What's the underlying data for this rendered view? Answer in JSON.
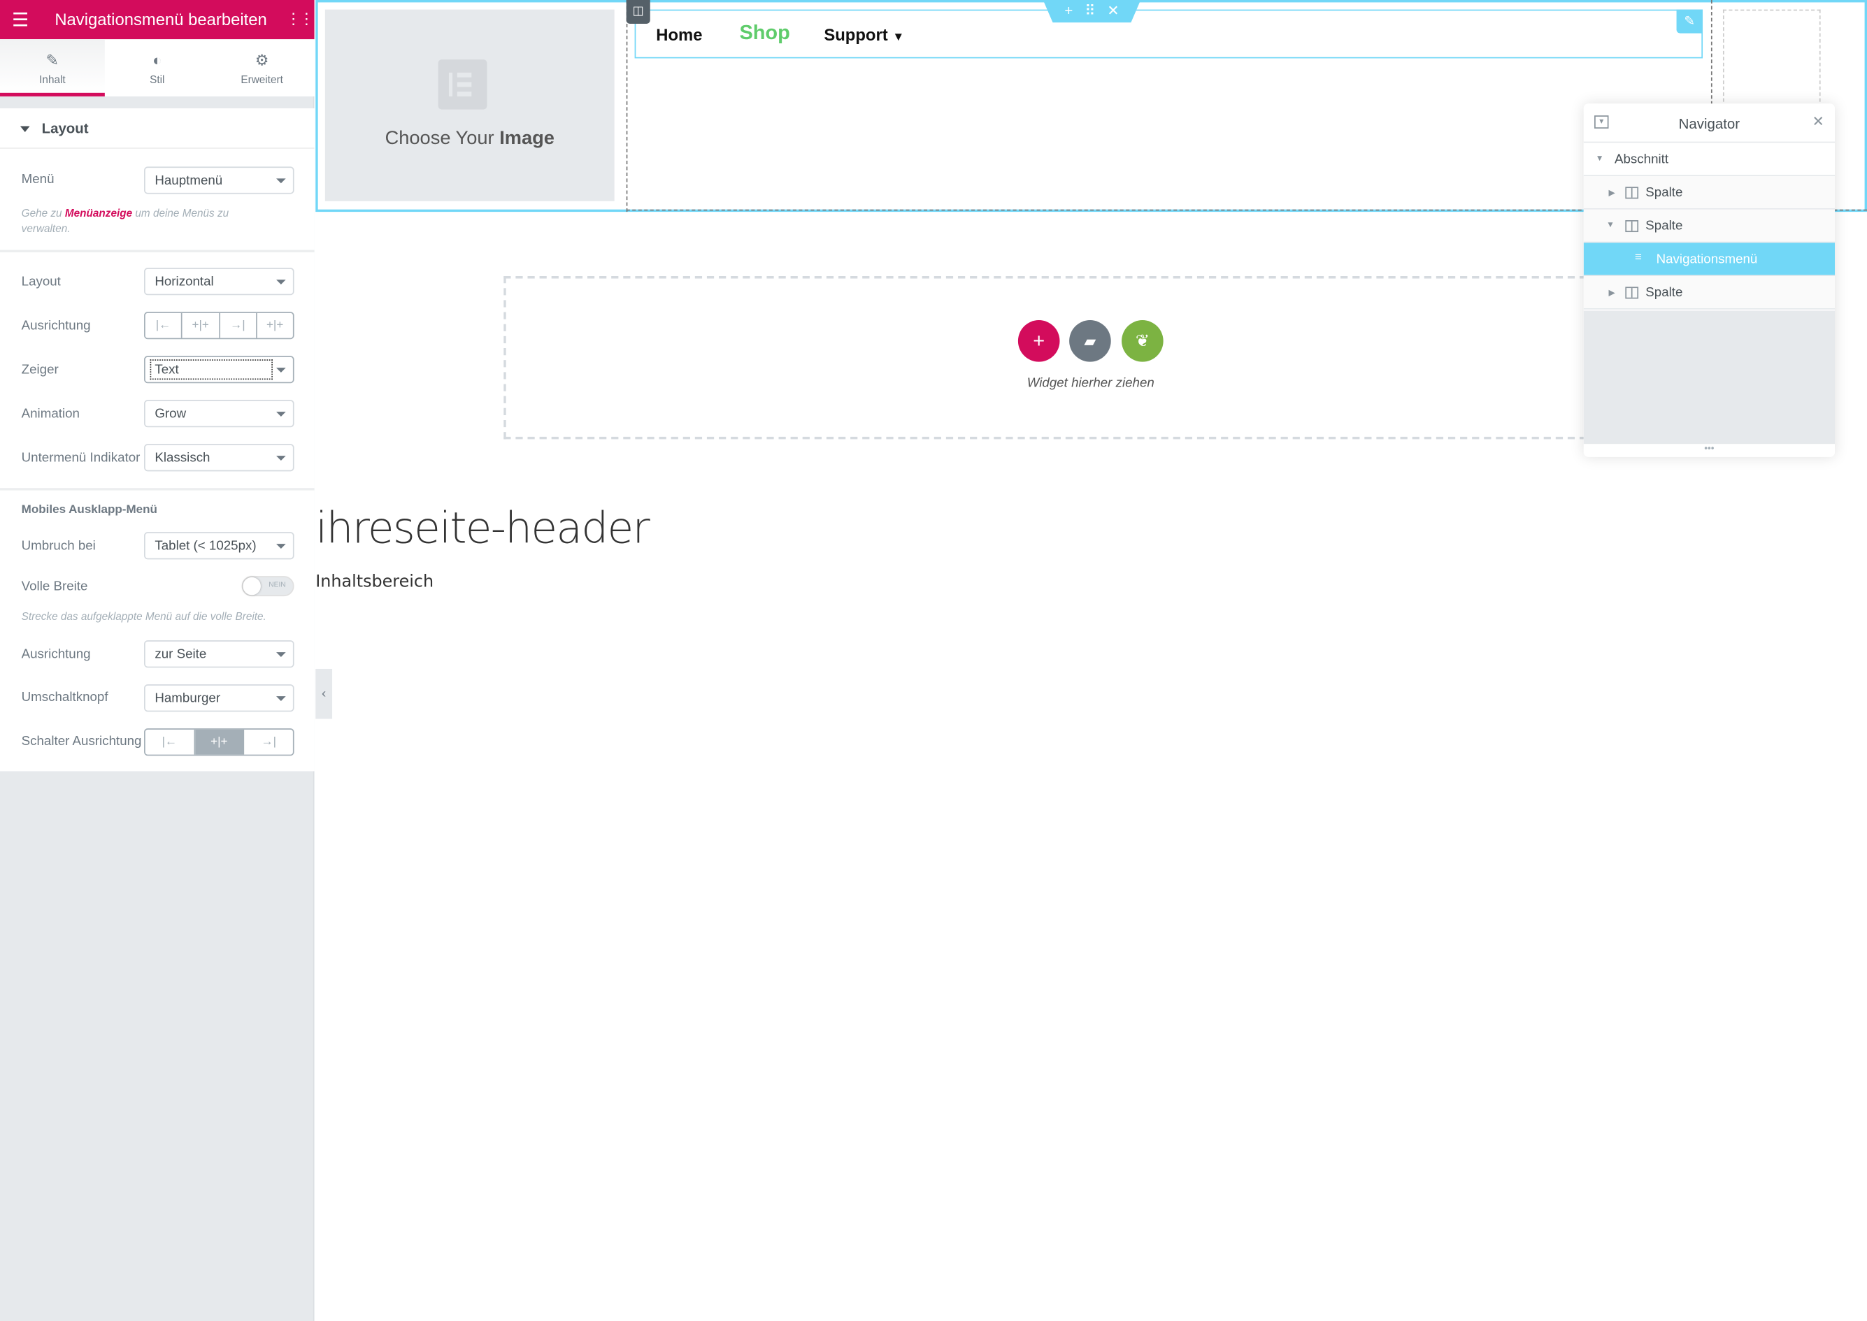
{
  "sidebar": {
    "title": "Navigationsmenü bearbeiten",
    "accent": "#d30c5c",
    "tabs": [
      {
        "label": "Inhalt",
        "icon": "pencil-icon",
        "active": true
      },
      {
        "label": "Stil",
        "icon": "half-circle-icon",
        "active": false
      },
      {
        "label": "Erweitert",
        "icon": "gear-icon",
        "active": false
      }
    ],
    "layout_section": {
      "title": "Layout",
      "menu_label": "Menü",
      "menu_value": "Hauptmenü",
      "hint_prefix": "Gehe zu",
      "hint_link": "Menüanzeige",
      "hint_suffix": "um deine Menüs zu verwalten.",
      "layout_label": "Layout",
      "layout_value": "Horizontal",
      "align_label": "Ausrichtung",
      "pointer_label": "Zeiger",
      "pointer_value": "Text",
      "animation_label": "Animation",
      "animation_value": "Grow",
      "submenu_label": "Untermenü Indikator",
      "submenu_value": "Klassisch"
    },
    "mobile_section": {
      "title": "Mobiles Ausklapp-Menü",
      "breakpoint_label": "Umbruch bei",
      "breakpoint_value": "Tablet (< 1025px)",
      "fullwidth_label": "Volle Breite",
      "fullwidth_toggle": "NEIN",
      "fullwidth_hint": "Strecke das aufgeklappte Menü auf die volle Breite.",
      "align_label": "Ausrichtung",
      "align_value": "zur Seite",
      "toggle_label": "Umschaltknopf",
      "toggle_value": "Hamburger",
      "toggle_align_label": "Schalter Ausrichtung",
      "toggle_align_selected": "center"
    }
  },
  "canvas": {
    "image_placeholder": {
      "light": "Choose Your",
      "bold": "Image"
    },
    "nav_items": [
      {
        "label": "Home",
        "color": "#111111"
      },
      {
        "label": "Shop",
        "color": "#5fcc6b"
      },
      {
        "label": "Support",
        "has_dropdown": true,
        "color": "#111111"
      }
    ],
    "drop_text": "Widget hierher ziehen",
    "page_heading": "ihreseite-header",
    "page_content": "Inhaltsbereich"
  },
  "navigator": {
    "title": "Navigator",
    "items": [
      {
        "label": "Abschnitt",
        "expanded": true
      },
      {
        "label": "Spalte",
        "expanded": false
      },
      {
        "label": "Spalte",
        "expanded": true
      },
      {
        "label": "Navigationsmenü",
        "selected": true
      },
      {
        "label": "Spalte",
        "expanded": false
      }
    ],
    "highlight": "#71d7f7"
  }
}
